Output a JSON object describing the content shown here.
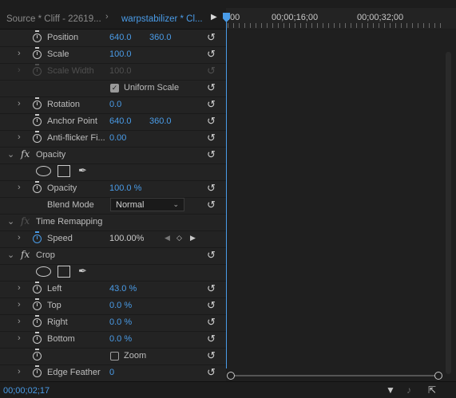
{
  "tabs": {
    "source": "Source * Cliff - 22619...",
    "clip": "warpstabilizer * Cl..."
  },
  "ruler": {
    "labels": [
      ":00",
      "00;00;16;00",
      "00;00;32;00"
    ]
  },
  "rows": {
    "position": {
      "label": "Position",
      "x": "640.0",
      "y": "360.0"
    },
    "scale": {
      "label": "Scale",
      "value": "100.0"
    },
    "scale_width": {
      "label": "Scale Width",
      "value": "100.0"
    },
    "uniform_scale": {
      "label": "Uniform Scale"
    },
    "rotation": {
      "label": "Rotation",
      "value": "0.0"
    },
    "anchor": {
      "label": "Anchor Point",
      "x": "640.0",
      "y": "360.0"
    },
    "antiflicker": {
      "label": "Anti-flicker Fi...",
      "value": "0.00"
    },
    "opacity_fx": {
      "label": "Opacity"
    },
    "opacity": {
      "label": "Opacity",
      "value": "100.0 %"
    },
    "blend": {
      "label": "Blend Mode",
      "value": "Normal"
    },
    "time_remap": {
      "label": "Time Remapping"
    },
    "speed": {
      "label": "Speed",
      "value": "100.00%"
    },
    "crop_fx": {
      "label": "Crop"
    },
    "left": {
      "label": "Left",
      "value": "43.0 %"
    },
    "top": {
      "label": "Top",
      "value": "0.0 %"
    },
    "right": {
      "label": "Right",
      "value": "0.0 %"
    },
    "bottom": {
      "label": "Bottom",
      "value": "0.0 %"
    },
    "zoom": {
      "label": "Zoom"
    },
    "edge_feather": {
      "label": "Edge Feather",
      "value": "0"
    }
  },
  "footer": {
    "timecode": "00;00;02;17"
  },
  "icons": {
    "reset": "reset-icon",
    "stopwatch": "stopwatch-icon",
    "filter": "filter-icon",
    "audio": "audio-icon",
    "export": "export-icon"
  },
  "colors": {
    "accent": "#4a9ce8",
    "panel": "#232323",
    "background": "#1d1d1d"
  }
}
